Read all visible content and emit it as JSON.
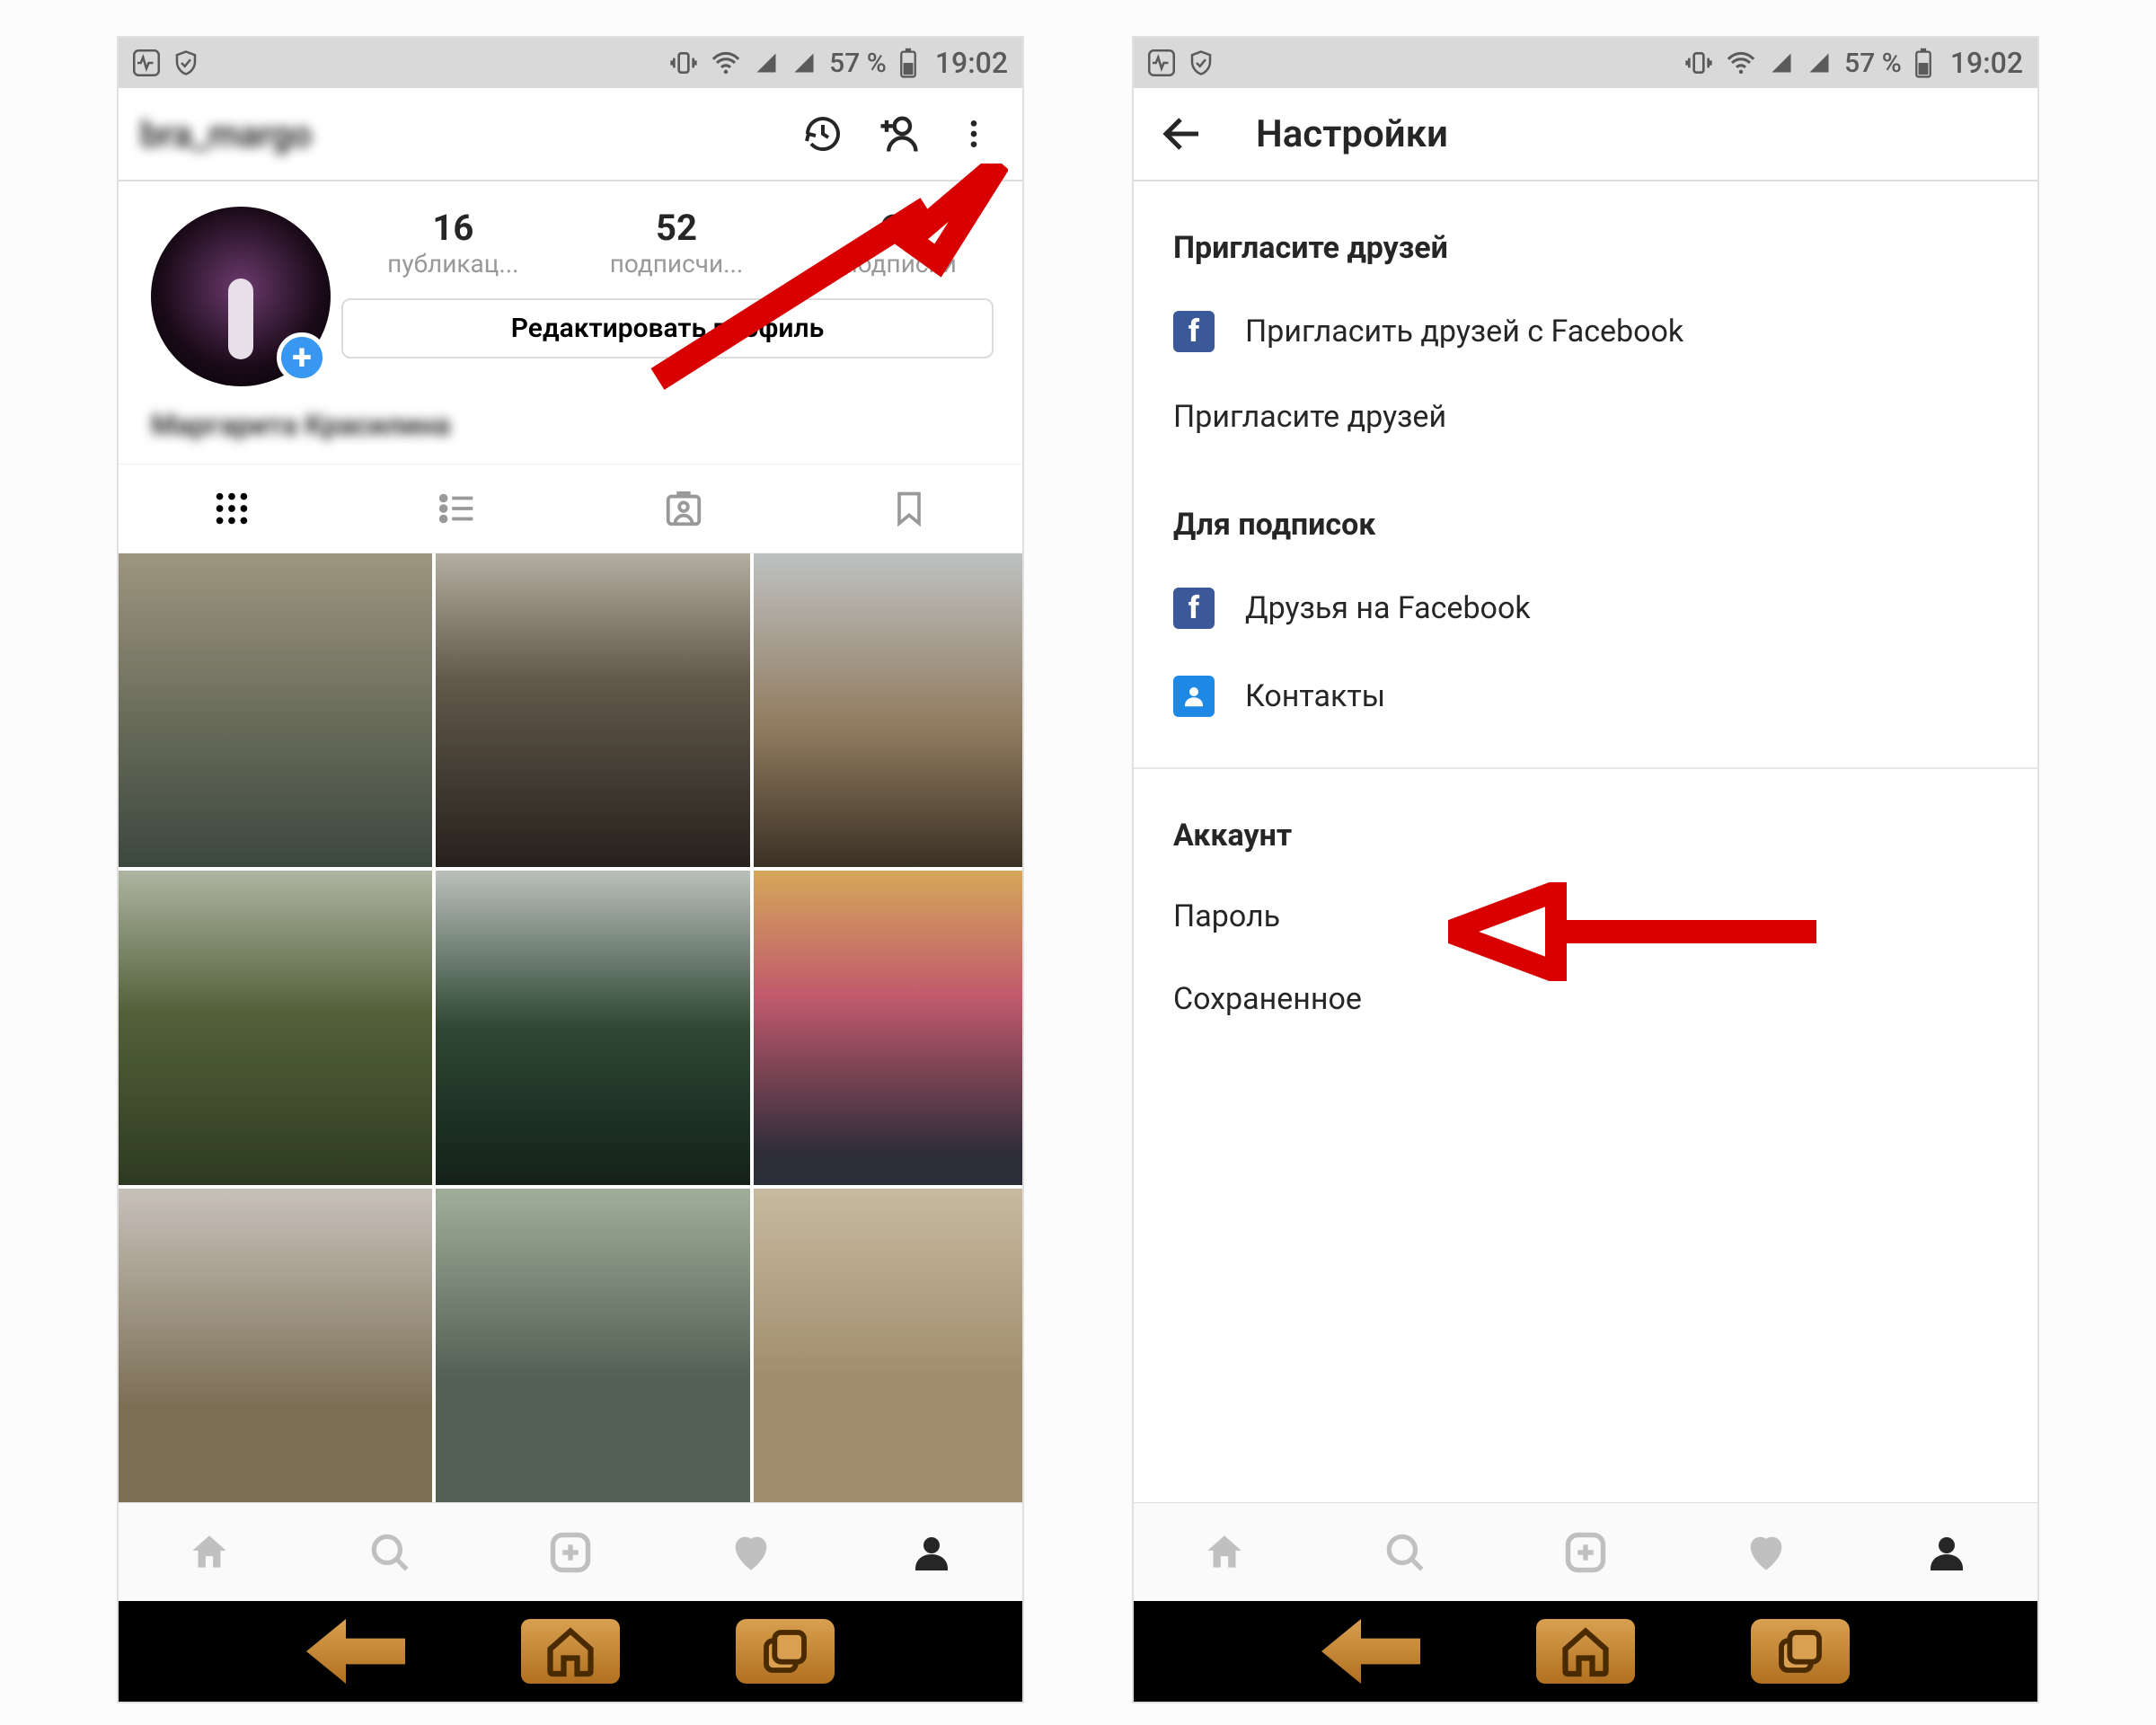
{
  "status": {
    "battery_pct": "57 %",
    "time": "19:02"
  },
  "profile": {
    "username": "bra_margo",
    "display_name": "Маргарита Красилина",
    "stats": {
      "posts": {
        "count": "16",
        "label": "публикац..."
      },
      "followers": {
        "count": "52",
        "label": "подписчи..."
      },
      "following": {
        "count": "62",
        "label": "подписки"
      }
    },
    "edit_button": "Редактировать профиль"
  },
  "settings": {
    "title": "Настройки",
    "invite_section": "Пригласите друзей",
    "invite_fb": "Пригласить друзей с Facebook",
    "invite_friends": "Пригласите друзей",
    "follow_section": "Для подписок",
    "fb_friends": "Друзья на Facebook",
    "contacts": "Контакты",
    "account_section": "Аккаунт",
    "password": "Пароль",
    "saved": "Сохраненное"
  }
}
